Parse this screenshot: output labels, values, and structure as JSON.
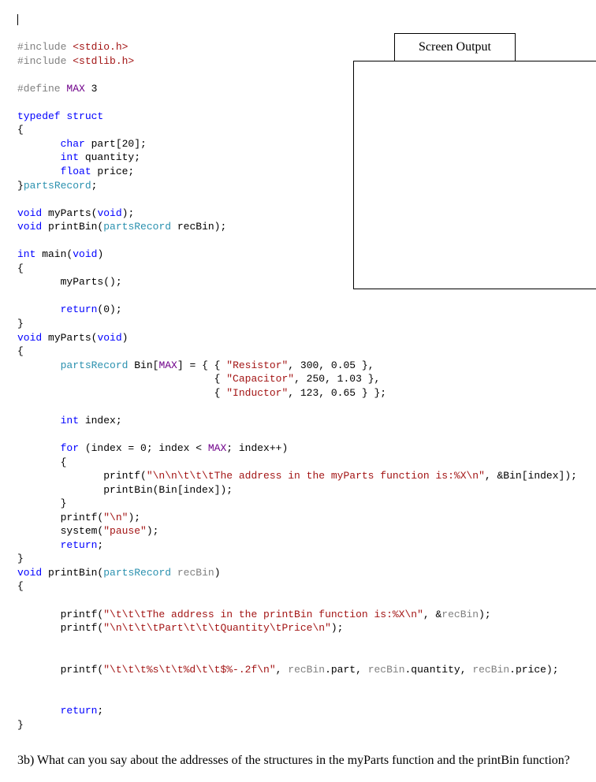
{
  "screen_output_label": "Screen Output",
  "code": {
    "l1a": "#include",
    "l1b": " <stdio.h>",
    "l2a": "#include",
    "l2b": " <stdlib.h>",
    "l3a": "#define",
    "l3b": " MAX",
    "l3c": " 3",
    "l4": "typedef struct",
    "l5": "{",
    "l6a": "       ",
    "l6b": "char",
    "l6c": " part[20];",
    "l7a": "       ",
    "l7b": "int",
    "l7c": " quantity;",
    "l8a": "       ",
    "l8b": "float",
    "l8c": " price;",
    "l9a": "}",
    "l9b": "partsRecord",
    "l9c": ";",
    "l10a": "void",
    "l10b": " myParts(",
    "l10c": "void",
    "l10d": ");",
    "l11a": "void",
    "l11b": " printBin(",
    "l11c": "partsRecord",
    "l11d": " recBin);",
    "l12a": "int",
    "l12b": " main(",
    "l12c": "void",
    "l12d": ")",
    "l13": "{",
    "l14": "       myParts();",
    "l15a": "       ",
    "l15b": "return",
    "l15c": "(0);",
    "l16": "}",
    "l17a": "void",
    "l17b": " myParts(",
    "l17c": "void",
    "l17d": ")",
    "l18": "{",
    "l19a": "       ",
    "l19b": "partsRecord",
    "l19c": " Bin[",
    "l19d": "MAX",
    "l19e": "] = { { ",
    "l19f": "\"Resistor\"",
    "l19g": ", 300, 0.05 },",
    "l20a": "                                { ",
    "l20b": "\"Capacitor\"",
    "l20c": ", 250, 1.03 },",
    "l21a": "                                { ",
    "l21b": "\"Inductor\"",
    "l21c": ", 123, 0.65 } };",
    "l22a": "       ",
    "l22b": "int",
    "l22c": " index;",
    "l23a": "       ",
    "l23b": "for",
    "l23c": " (index = 0; index < ",
    "l23d": "MAX",
    "l23e": "; index++)",
    "l24": "       {",
    "l25a": "              printf(",
    "l25b": "\"\\n\\n\\t\\t\\tThe address in the myParts function is:%X\\n\"",
    "l25c": ", &Bin[index]);",
    "l26": "              printBin(Bin[index]);",
    "l27": "       }",
    "l28a": "       printf(",
    "l28b": "\"\\n\"",
    "l28c": ");",
    "l29a": "       system(",
    "l29b": "\"pause\"",
    "l29c": ");",
    "l30a": "       ",
    "l30b": "return",
    "l30c": ";",
    "l31": "}",
    "l32a": "void",
    "l32b": " printBin(",
    "l32c": "partsRecord",
    "l32d": " ",
    "l32e": "recBin",
    "l32f": ")",
    "l33": "{",
    "l34a": "       printf(",
    "l34b": "\"\\t\\t\\tThe address in the printBin function is:%X\\n\"",
    "l34c": ", &",
    "l34d": "recBin",
    "l34e": ");",
    "l35a": "       printf(",
    "l35b": "\"\\n\\t\\t\\tPart\\t\\t\\tQuantity\\tPrice\\n\"",
    "l35c": ");",
    "l36a": "       printf(",
    "l36b": "\"\\t\\t\\t%s\\t\\t%d\\t\\t$%-.2f\\n\"",
    "l36c": ", ",
    "l36d": "recBin",
    "l36e": ".part, ",
    "l36f": "recBin",
    "l36g": ".quantity, ",
    "l36h": "recBin",
    "l36i": ".price);",
    "l37a": "       ",
    "l37b": "return",
    "l37c": ";",
    "l38": "}"
  },
  "question": "3b) What can you say about the addresses of the structures in the myParts function and the printBin function?"
}
